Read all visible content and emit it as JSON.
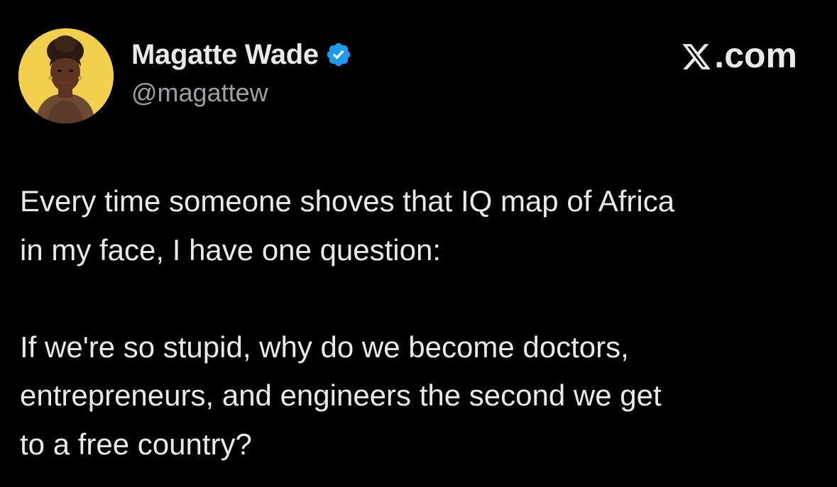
{
  "author": {
    "display_name": "Magatte Wade",
    "handle": "@magattew",
    "verified": true,
    "verified_icon": "verified-badge-icon",
    "avatar_icon": "profile-avatar"
  },
  "brand": {
    "label": ".com",
    "logo_icon": "x-logo-icon"
  },
  "tweet": {
    "paragraph_1": [
      "Every time someone shoves that IQ map of Africa",
      "in my face, I have one question:"
    ],
    "paragraph_2": [
      "If we're so stupid, why do we become doctors,",
      "entrepreneurs, and engineers the second we get",
      "to a free country?"
    ]
  },
  "colors": {
    "background": "#000000",
    "text_primary": "#e7e9ea",
    "text_secondary": "#9c9fa3",
    "verified_blue": "#1d9bf0",
    "avatar_background": "#f3cf4e"
  }
}
